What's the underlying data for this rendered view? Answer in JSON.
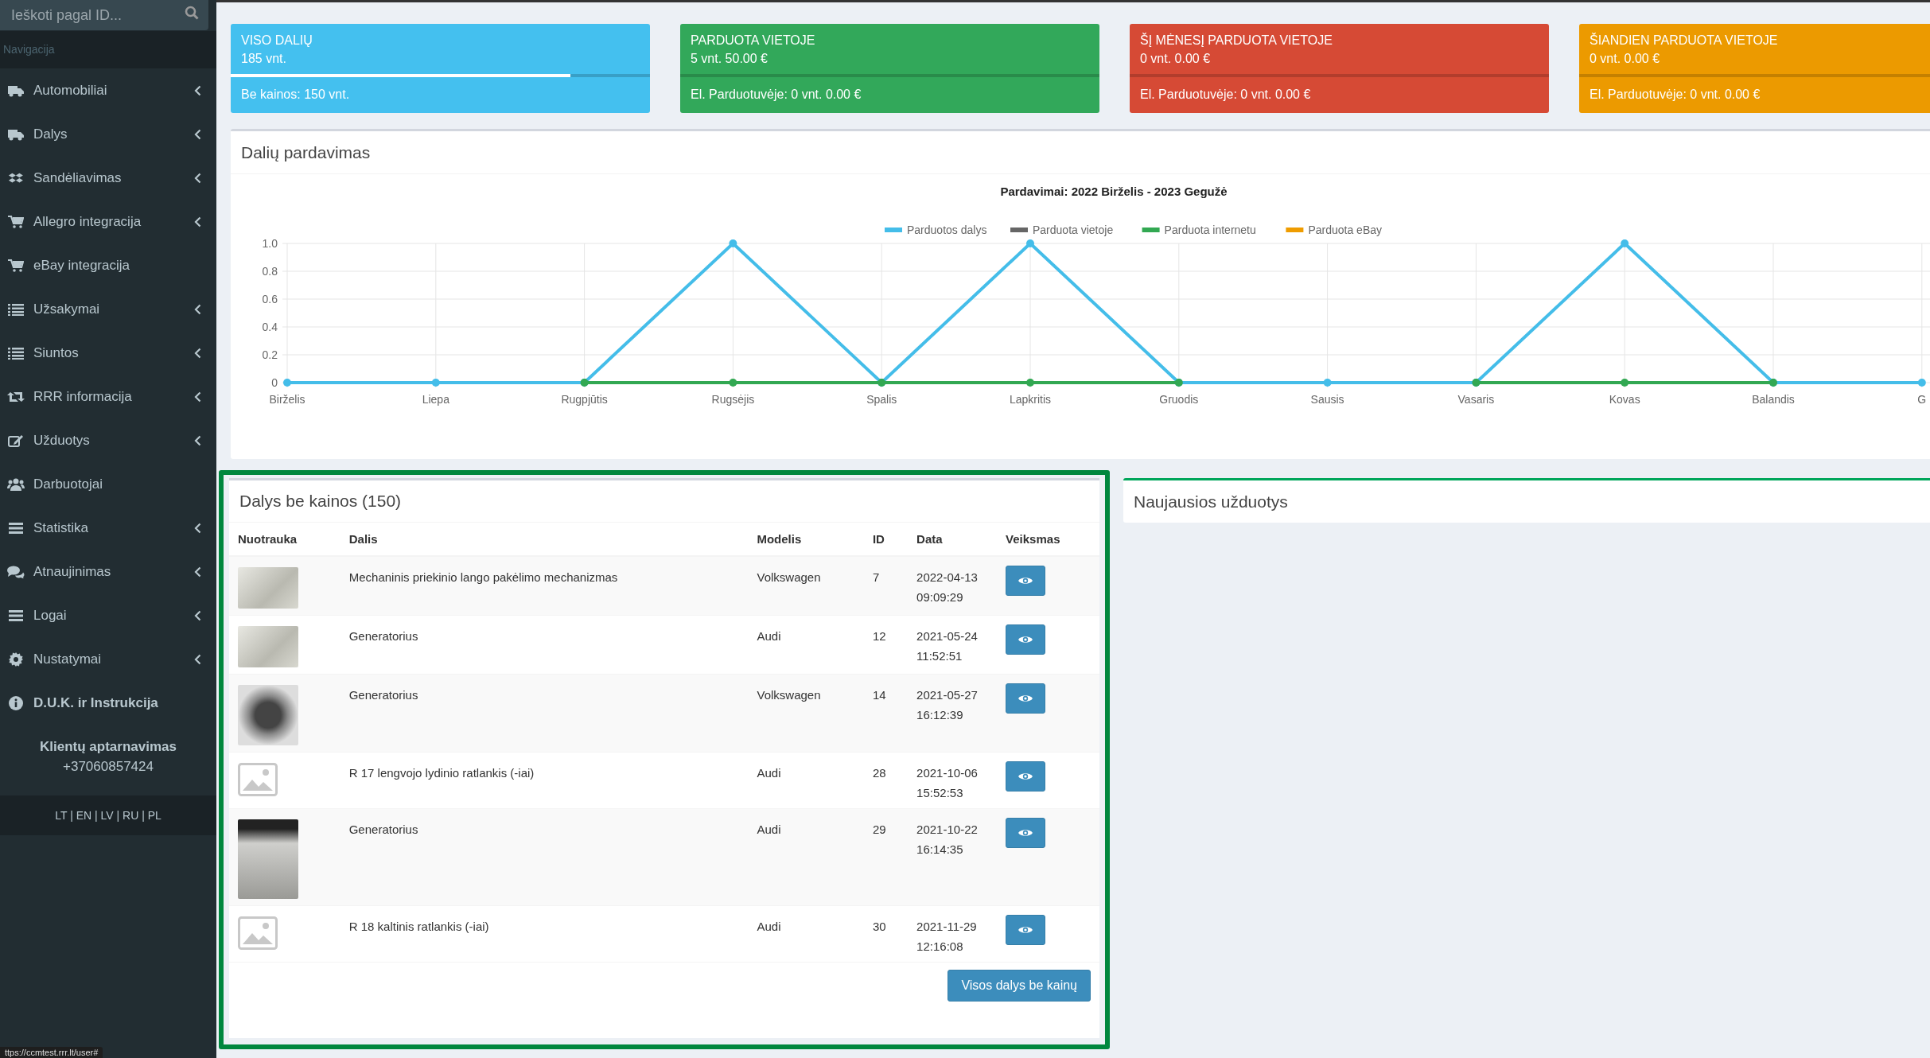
{
  "sidebar": {
    "search": {
      "placeholder": "Ieškoti pagal ID..."
    },
    "nav_header": "Navigacija",
    "items": [
      {
        "label": "Automobiliai",
        "has_submenu": true,
        "emphasized": false
      },
      {
        "label": "Dalys",
        "has_submenu": true,
        "emphasized": false
      },
      {
        "label": "Sandėliavimas",
        "has_submenu": true,
        "emphasized": false
      },
      {
        "label": "Allegro integracija",
        "has_submenu": true,
        "emphasized": false
      },
      {
        "label": "eBay integracija",
        "has_submenu": false,
        "emphasized": false
      },
      {
        "label": "Užsakymai",
        "has_submenu": true,
        "emphasized": false
      },
      {
        "label": "Siuntos",
        "has_submenu": true,
        "emphasized": false
      },
      {
        "label": "RRR informacija",
        "has_submenu": true,
        "emphasized": false
      },
      {
        "label": "Užduotys",
        "has_submenu": true,
        "emphasized": false
      },
      {
        "label": "Darbuotojai",
        "has_submenu": false,
        "emphasized": false
      },
      {
        "label": "Statistika",
        "has_submenu": true,
        "emphasized": false
      },
      {
        "label": "Atnaujinimas",
        "has_submenu": true,
        "emphasized": false
      },
      {
        "label": "Logai",
        "has_submenu": true,
        "emphasized": false
      },
      {
        "label": "Nustatymai",
        "has_submenu": true,
        "emphasized": false
      },
      {
        "label": "D.U.K. ir Instrukcija",
        "has_submenu": false,
        "emphasized": true
      }
    ],
    "support": {
      "title": "Klientų aptarnavimas",
      "phone": "+37060857424"
    },
    "languages": "LT | EN | LV | RU | PL"
  },
  "stat_cards": [
    {
      "title": "VISO DALIŲ",
      "value": "185 vnt.",
      "footer": "Be kainos: 150 vnt.",
      "color": "#44c0ef",
      "level": 0.81
    },
    {
      "title": "PARDUOTA VIETOJE",
      "value": "5 vnt. 50.00 €",
      "footer": "El. Parduotuvėje: 0 vnt. 0.00 €",
      "color": "#32a85a",
      "level": 0
    },
    {
      "title": "ŠĮ MĖNESĮ PARDUOTA VIETOJE",
      "value": "0 vnt. 0.00 €",
      "footer": "El. Parduotuvėje: 0 vnt. 0.00 €",
      "color": "#d64a35",
      "level": 0
    },
    {
      "title": "ŠIANDIEN PARDUOTA VIETOJE",
      "value": "0 vnt. 0.00 €",
      "footer": "El. Parduotuvėje: 0 vnt. 0.00 €",
      "color": "#ec9a00",
      "level": 0
    }
  ],
  "sales_panel": {
    "title": "Dalių pardavimas",
    "chart_data": {
      "type": "line",
      "title": "Pardavimai: 2022 Birželis - 2023 Gegužė",
      "categories": [
        "Birželis",
        "Liepa",
        "Rugpjūtis",
        "Rugsėjis",
        "Spalis",
        "Lapkritis",
        "Gruodis",
        "Sausis",
        "Vasaris",
        "Kovas",
        "Balandis",
        "G"
      ],
      "series": [
        {
          "name": "Parduotos dalys",
          "color": "#44bde9",
          "marker": "circle",
          "values": [
            0,
            0,
            0,
            1,
            0,
            1,
            0,
            0,
            0,
            1,
            0,
            0
          ]
        },
        {
          "name": "Parduota vietoje",
          "color": "#666666",
          "values": [
            null,
            null,
            null,
            null,
            null,
            null,
            null,
            null,
            null,
            null,
            null,
            null
          ]
        },
        {
          "name": "Parduota internetu",
          "color": "#32a852",
          "marker": "circle",
          "values": [
            null,
            null,
            0,
            0,
            0,
            0,
            0,
            null,
            0,
            0,
            0,
            null
          ]
        },
        {
          "name": "Parduota eBay",
          "color": "#ef9c00",
          "values": [
            null,
            null,
            null,
            null,
            null,
            null,
            null,
            null,
            null,
            null,
            null,
            null
          ]
        }
      ],
      "grid": true,
      "legend": true,
      "ylim": [
        0,
        1
      ],
      "yticks": [
        0,
        0.2,
        0.4,
        0.6,
        0.8,
        {
          "value": 1,
          "label": "1.0"
        }
      ]
    }
  },
  "parts_panel": {
    "title": "Dalys be kainos (150)",
    "columns": [
      "Nuotrauka",
      "Dalis",
      "Modelis",
      "ID",
      "Data",
      "Veiksmas"
    ],
    "rows": [
      {
        "kind": "landscape",
        "part": "Mechaninis priekinio lango pakėlimo mechanizmas",
        "model": "Volkswagen",
        "id": "7",
        "date": "2022-04-13 09:09:29"
      },
      {
        "kind": "landscape",
        "part": "Generatorius",
        "model": "Audi",
        "id": "12",
        "date": "2021-05-24 11:52:51"
      },
      {
        "kind": "square",
        "part": "Generatorius",
        "model": "Volkswagen",
        "id": "14",
        "date": "2021-05-27 16:12:39"
      },
      {
        "kind": "placeholder",
        "part": "R 17 lengvojo lydinio ratlankis (-iai)",
        "model": "Audi",
        "id": "28",
        "date": "2021-10-06 15:52:53"
      },
      {
        "kind": "portrait",
        "part": "Generatorius",
        "model": "Audi",
        "id": "29",
        "date": "2021-10-22 16:14:35"
      },
      {
        "kind": "placeholder",
        "part": "R 18 kaltinis ratlankis (-iai)",
        "model": "Audi",
        "id": "30",
        "date": "2021-11-29 12:16:08"
      }
    ],
    "button": "Visos dalys be kainų"
  },
  "tasks_panel": {
    "title": "Naujausios užduotys"
  },
  "status_url": "ttps://ccmtest.rrr.lt/user#"
}
